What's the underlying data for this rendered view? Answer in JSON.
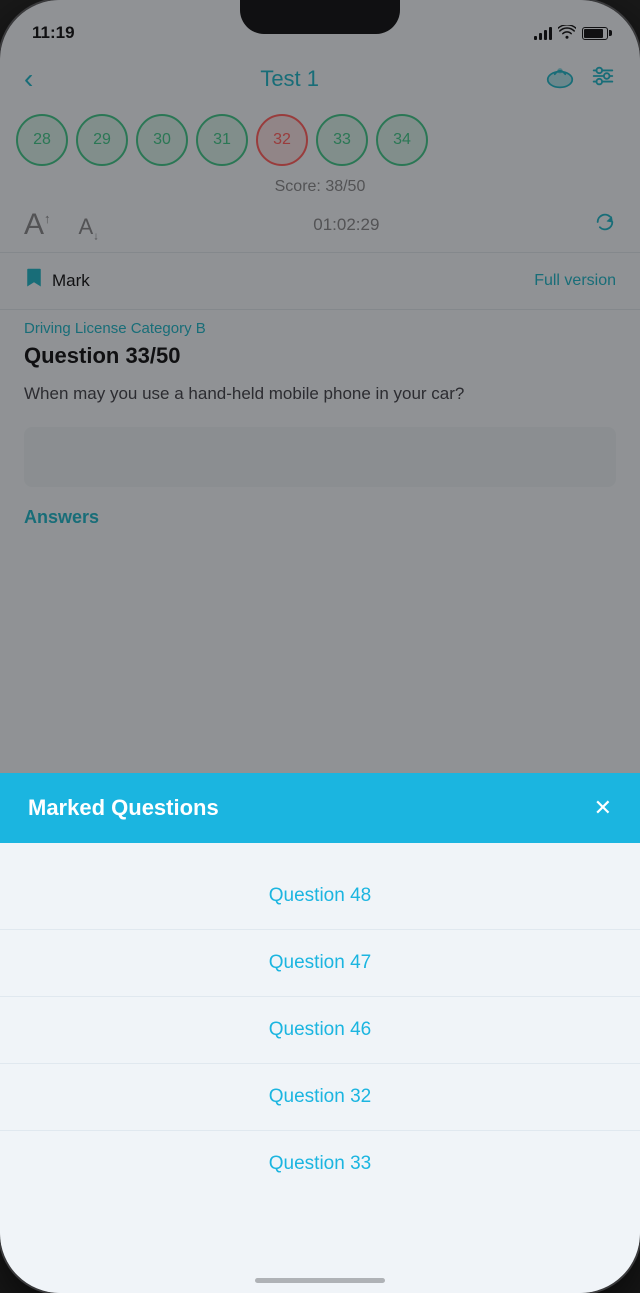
{
  "status_bar": {
    "time": "11:19",
    "signal_label": "signal",
    "wifi_label": "wifi",
    "battery_label": "battery"
  },
  "header": {
    "back_label": "‹",
    "title": "Test 1",
    "sync_icon": "☁",
    "settings_icon": "⊞"
  },
  "question_numbers": [
    {
      "num": "28",
      "state": "correct"
    },
    {
      "num": "29",
      "state": "correct"
    },
    {
      "num": "30",
      "state": "correct"
    },
    {
      "num": "31",
      "state": "correct"
    },
    {
      "num": "32",
      "state": "incorrect"
    },
    {
      "num": "33",
      "state": "correct"
    },
    {
      "num": "34",
      "state": "correct"
    }
  ],
  "score": {
    "label": "Score: 38/50"
  },
  "font_controls": {
    "large_a": "A",
    "small_a": "A",
    "timer": "01:02:29"
  },
  "mark_row": {
    "bookmark": "🔖",
    "mark_label": "Mark",
    "full_version_label": "Full version"
  },
  "question": {
    "category": "Driving License Category B",
    "number_label": "Question 33/50",
    "text": "When may you use a hand-held mobile phone in your car?"
  },
  "answers": {
    "label": "Answers"
  },
  "modal": {
    "title": "Marked Questions",
    "close_label": "✕",
    "items": [
      {
        "label": "Question 48"
      },
      {
        "label": "Question 47"
      },
      {
        "label": "Question 46"
      },
      {
        "label": "Question 32"
      },
      {
        "label": "Question 33"
      }
    ]
  }
}
